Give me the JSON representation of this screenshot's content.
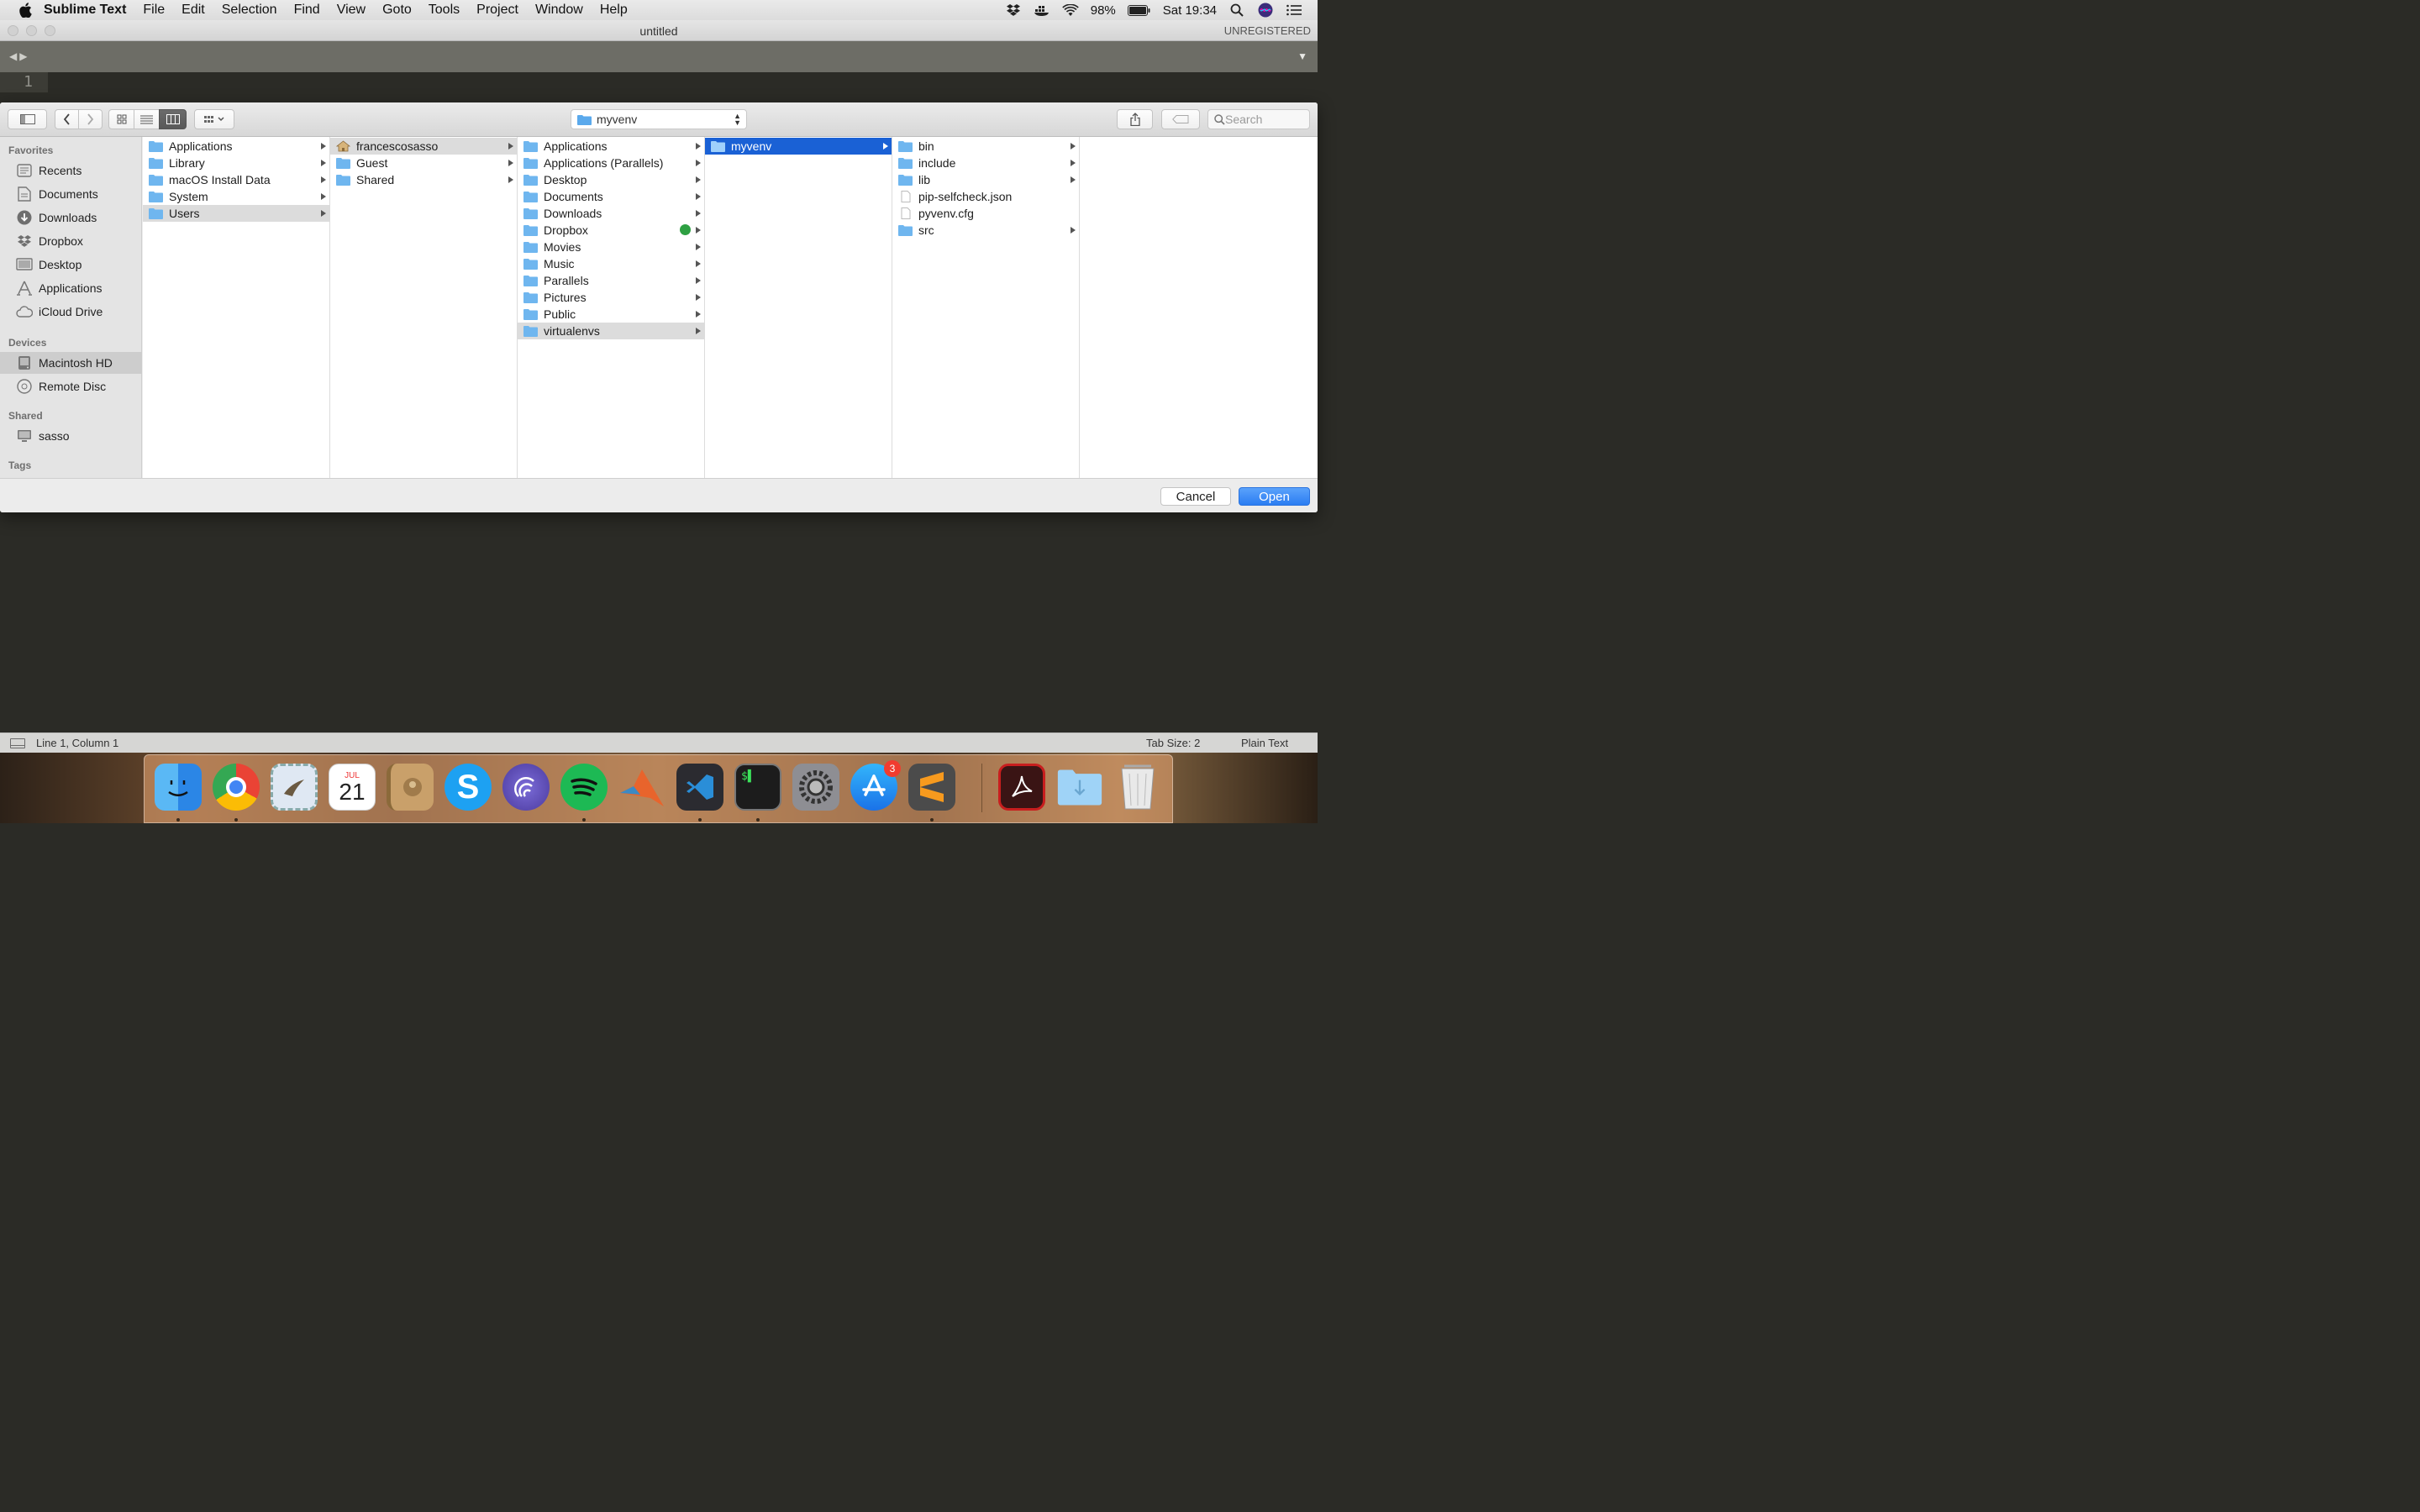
{
  "menubar": {
    "app_name": "Sublime Text",
    "items": [
      "File",
      "Edit",
      "Selection",
      "Find",
      "View",
      "Goto",
      "Tools",
      "Project",
      "Window",
      "Help"
    ],
    "battery": "98%",
    "clock": "Sat 19:34"
  },
  "window": {
    "title": "untitled",
    "registration": "UNREGISTERED",
    "line_number": "1"
  },
  "dialog": {
    "path_popup": "myvenv",
    "search_placeholder": "Search",
    "sidebar": {
      "favorites_label": "Favorites",
      "favorites": [
        {
          "label": "Recents",
          "icon": "clock-icon"
        },
        {
          "label": "Documents",
          "icon": "documents-icon"
        },
        {
          "label": "Downloads",
          "icon": "downloads-icon"
        },
        {
          "label": "Dropbox",
          "icon": "dropbox-icon"
        },
        {
          "label": "Desktop",
          "icon": "desktop-icon"
        },
        {
          "label": "Applications",
          "icon": "applications-icon"
        },
        {
          "label": "iCloud Drive",
          "icon": "cloud-icon"
        }
      ],
      "devices_label": "Devices",
      "devices": [
        {
          "label": "Macintosh HD",
          "icon": "hard-disk-icon"
        },
        {
          "label": "Remote Disc",
          "icon": "disc-icon"
        }
      ],
      "shared_label": "Shared",
      "shared": [
        {
          "label": "sasso",
          "icon": "computer-icon"
        }
      ],
      "tags_label": "Tags"
    },
    "columns": [
      {
        "items": [
          "Applications",
          "Library",
          "macOS Install Data",
          "System",
          "Users"
        ],
        "selected": "Users"
      },
      {
        "items": [
          "francescosasso",
          "Guest",
          "Shared"
        ],
        "selected": "francescosasso"
      },
      {
        "items": [
          "Applications",
          "Applications (Parallels)",
          "Desktop",
          "Documents",
          "Downloads",
          "Dropbox",
          "Movies",
          "Music",
          "Parallels",
          "Pictures",
          "Public",
          "virtualenvs"
        ],
        "selected": "virtualenvs"
      },
      {
        "items": [
          "myvenv"
        ],
        "selected": "myvenv"
      },
      {
        "items": [
          "bin",
          "include",
          "lib",
          "pip-selfcheck.json",
          "pyvenv.cfg",
          "src"
        ],
        "selected": ""
      }
    ],
    "cancel_label": "Cancel",
    "open_label": "Open"
  },
  "statusbar": {
    "position": "Line 1, Column 1",
    "tab_size": "Tab Size: 2",
    "syntax": "Plain Text"
  },
  "dock": {
    "apps": [
      "Finder",
      "Chrome",
      "Mail",
      "Calendar",
      "Contacts",
      "Skype",
      "Torrent",
      "Spotify",
      "MATLAB",
      "VS Code",
      "Terminal",
      "System Preferences",
      "App Store",
      "Sublime Text",
      "Acrobat",
      "Downloads folder",
      "Trash"
    ],
    "calendar_month": "JUL",
    "calendar_day": "21",
    "app_store_badge": "3"
  }
}
